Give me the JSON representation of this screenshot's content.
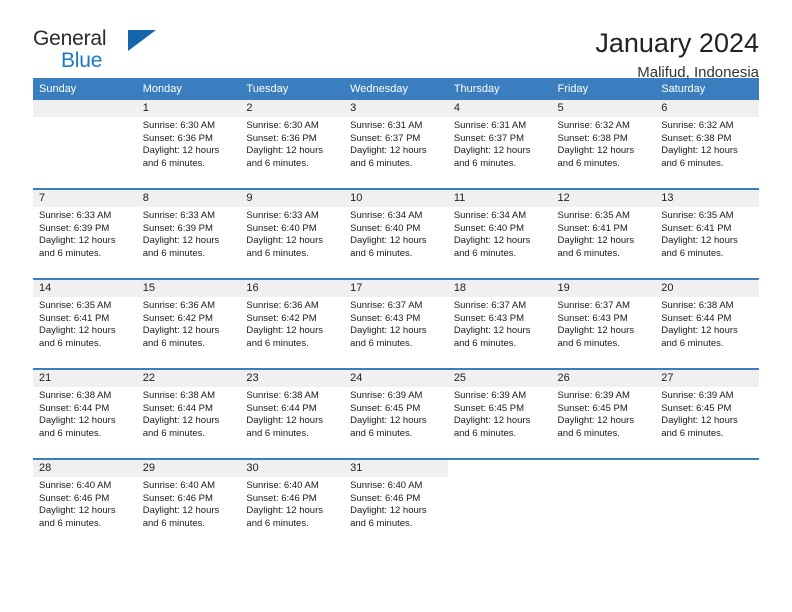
{
  "brand": {
    "name_part1": "General",
    "name_part2": "Blue",
    "logo_icon": "triangle-flag-icon"
  },
  "header": {
    "title": "January 2024",
    "location": "Malifud, Indonesia"
  },
  "calendar": {
    "weekday_headers": [
      "Sunday",
      "Monday",
      "Tuesday",
      "Wednesday",
      "Thursday",
      "Friday",
      "Saturday"
    ],
    "accent_color": "#3a7ebf",
    "daynum_bg": "#f0f0f0",
    "weeks": [
      [
        {
          "day": "",
          "sunrise": "",
          "sunset": "",
          "daylight1": "",
          "daylight2": "",
          "empty": true
        },
        {
          "day": "1",
          "sunrise": "Sunrise: 6:30 AM",
          "sunset": "Sunset: 6:36 PM",
          "daylight1": "Daylight: 12 hours",
          "daylight2": "and 6 minutes."
        },
        {
          "day": "2",
          "sunrise": "Sunrise: 6:30 AM",
          "sunset": "Sunset: 6:36 PM",
          "daylight1": "Daylight: 12 hours",
          "daylight2": "and 6 minutes."
        },
        {
          "day": "3",
          "sunrise": "Sunrise: 6:31 AM",
          "sunset": "Sunset: 6:37 PM",
          "daylight1": "Daylight: 12 hours",
          "daylight2": "and 6 minutes."
        },
        {
          "day": "4",
          "sunrise": "Sunrise: 6:31 AM",
          "sunset": "Sunset: 6:37 PM",
          "daylight1": "Daylight: 12 hours",
          "daylight2": "and 6 minutes."
        },
        {
          "day": "5",
          "sunrise": "Sunrise: 6:32 AM",
          "sunset": "Sunset: 6:38 PM",
          "daylight1": "Daylight: 12 hours",
          "daylight2": "and 6 minutes."
        },
        {
          "day": "6",
          "sunrise": "Sunrise: 6:32 AM",
          "sunset": "Sunset: 6:38 PM",
          "daylight1": "Daylight: 12 hours",
          "daylight2": "and 6 minutes."
        }
      ],
      [
        {
          "day": "7",
          "sunrise": "Sunrise: 6:33 AM",
          "sunset": "Sunset: 6:39 PM",
          "daylight1": "Daylight: 12 hours",
          "daylight2": "and 6 minutes."
        },
        {
          "day": "8",
          "sunrise": "Sunrise: 6:33 AM",
          "sunset": "Sunset: 6:39 PM",
          "daylight1": "Daylight: 12 hours",
          "daylight2": "and 6 minutes."
        },
        {
          "day": "9",
          "sunrise": "Sunrise: 6:33 AM",
          "sunset": "Sunset: 6:40 PM",
          "daylight1": "Daylight: 12 hours",
          "daylight2": "and 6 minutes."
        },
        {
          "day": "10",
          "sunrise": "Sunrise: 6:34 AM",
          "sunset": "Sunset: 6:40 PM",
          "daylight1": "Daylight: 12 hours",
          "daylight2": "and 6 minutes."
        },
        {
          "day": "11",
          "sunrise": "Sunrise: 6:34 AM",
          "sunset": "Sunset: 6:40 PM",
          "daylight1": "Daylight: 12 hours",
          "daylight2": "and 6 minutes."
        },
        {
          "day": "12",
          "sunrise": "Sunrise: 6:35 AM",
          "sunset": "Sunset: 6:41 PM",
          "daylight1": "Daylight: 12 hours",
          "daylight2": "and 6 minutes."
        },
        {
          "day": "13",
          "sunrise": "Sunrise: 6:35 AM",
          "sunset": "Sunset: 6:41 PM",
          "daylight1": "Daylight: 12 hours",
          "daylight2": "and 6 minutes."
        }
      ],
      [
        {
          "day": "14",
          "sunrise": "Sunrise: 6:35 AM",
          "sunset": "Sunset: 6:41 PM",
          "daylight1": "Daylight: 12 hours",
          "daylight2": "and 6 minutes."
        },
        {
          "day": "15",
          "sunrise": "Sunrise: 6:36 AM",
          "sunset": "Sunset: 6:42 PM",
          "daylight1": "Daylight: 12 hours",
          "daylight2": "and 6 minutes."
        },
        {
          "day": "16",
          "sunrise": "Sunrise: 6:36 AM",
          "sunset": "Sunset: 6:42 PM",
          "daylight1": "Daylight: 12 hours",
          "daylight2": "and 6 minutes."
        },
        {
          "day": "17",
          "sunrise": "Sunrise: 6:37 AM",
          "sunset": "Sunset: 6:43 PM",
          "daylight1": "Daylight: 12 hours",
          "daylight2": "and 6 minutes."
        },
        {
          "day": "18",
          "sunrise": "Sunrise: 6:37 AM",
          "sunset": "Sunset: 6:43 PM",
          "daylight1": "Daylight: 12 hours",
          "daylight2": "and 6 minutes."
        },
        {
          "day": "19",
          "sunrise": "Sunrise: 6:37 AM",
          "sunset": "Sunset: 6:43 PM",
          "daylight1": "Daylight: 12 hours",
          "daylight2": "and 6 minutes."
        },
        {
          "day": "20",
          "sunrise": "Sunrise: 6:38 AM",
          "sunset": "Sunset: 6:44 PM",
          "daylight1": "Daylight: 12 hours",
          "daylight2": "and 6 minutes."
        }
      ],
      [
        {
          "day": "21",
          "sunrise": "Sunrise: 6:38 AM",
          "sunset": "Sunset: 6:44 PM",
          "daylight1": "Daylight: 12 hours",
          "daylight2": "and 6 minutes."
        },
        {
          "day": "22",
          "sunrise": "Sunrise: 6:38 AM",
          "sunset": "Sunset: 6:44 PM",
          "daylight1": "Daylight: 12 hours",
          "daylight2": "and 6 minutes."
        },
        {
          "day": "23",
          "sunrise": "Sunrise: 6:38 AM",
          "sunset": "Sunset: 6:44 PM",
          "daylight1": "Daylight: 12 hours",
          "daylight2": "and 6 minutes."
        },
        {
          "day": "24",
          "sunrise": "Sunrise: 6:39 AM",
          "sunset": "Sunset: 6:45 PM",
          "daylight1": "Daylight: 12 hours",
          "daylight2": "and 6 minutes."
        },
        {
          "day": "25",
          "sunrise": "Sunrise: 6:39 AM",
          "sunset": "Sunset: 6:45 PM",
          "daylight1": "Daylight: 12 hours",
          "daylight2": "and 6 minutes."
        },
        {
          "day": "26",
          "sunrise": "Sunrise: 6:39 AM",
          "sunset": "Sunset: 6:45 PM",
          "daylight1": "Daylight: 12 hours",
          "daylight2": "and 6 minutes."
        },
        {
          "day": "27",
          "sunrise": "Sunrise: 6:39 AM",
          "sunset": "Sunset: 6:45 PM",
          "daylight1": "Daylight: 12 hours",
          "daylight2": "and 6 minutes."
        }
      ],
      [
        {
          "day": "28",
          "sunrise": "Sunrise: 6:40 AM",
          "sunset": "Sunset: 6:46 PM",
          "daylight1": "Daylight: 12 hours",
          "daylight2": "and 6 minutes."
        },
        {
          "day": "29",
          "sunrise": "Sunrise: 6:40 AM",
          "sunset": "Sunset: 6:46 PM",
          "daylight1": "Daylight: 12 hours",
          "daylight2": "and 6 minutes."
        },
        {
          "day": "30",
          "sunrise": "Sunrise: 6:40 AM",
          "sunset": "Sunset: 6:46 PM",
          "daylight1": "Daylight: 12 hours",
          "daylight2": "and 6 minutes."
        },
        {
          "day": "31",
          "sunrise": "Sunrise: 6:40 AM",
          "sunset": "Sunset: 6:46 PM",
          "daylight1": "Daylight: 12 hours",
          "daylight2": "and 6 minutes."
        },
        {
          "day": "",
          "sunrise": "",
          "sunset": "",
          "daylight1": "",
          "daylight2": "",
          "blank": true
        },
        {
          "day": "",
          "sunrise": "",
          "sunset": "",
          "daylight1": "",
          "daylight2": "",
          "blank": true
        },
        {
          "day": "",
          "sunrise": "",
          "sunset": "",
          "daylight1": "",
          "daylight2": "",
          "blank": true
        }
      ]
    ]
  }
}
